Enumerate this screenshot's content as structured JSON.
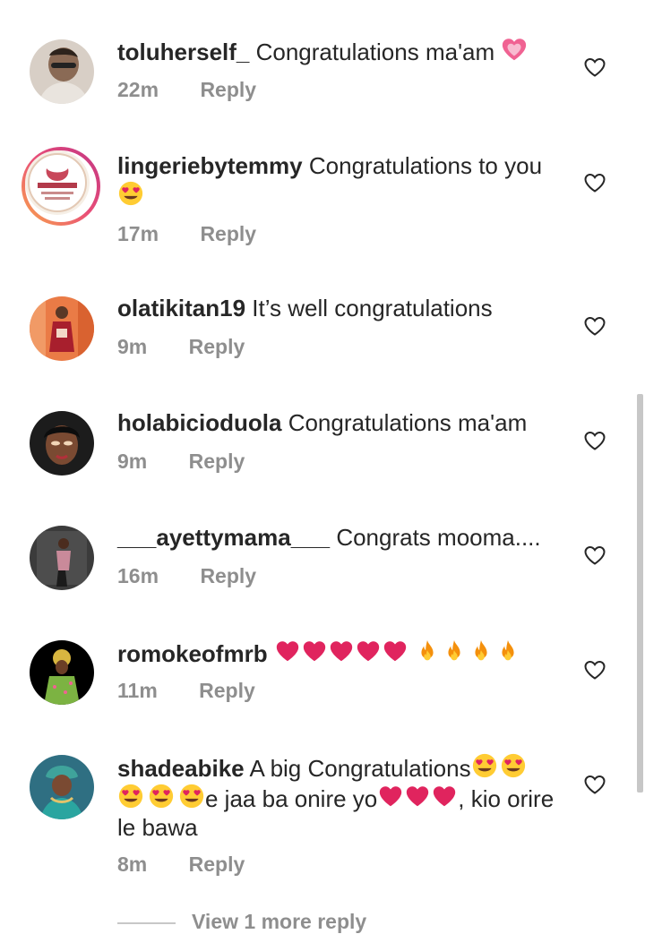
{
  "comments": [
    {
      "username": "toluherself_",
      "text": "Congratulations ma'am",
      "time": "22m",
      "reply": "Reply"
    },
    {
      "username": "lingeriebytemmy",
      "text": "Congratulations to you",
      "time": "17m",
      "reply": "Reply"
    },
    {
      "username": "olatikitan19",
      "text": "It’s well congratulations",
      "time": "9m",
      "reply": "Reply"
    },
    {
      "username": "holabicioduola",
      "text": "Congratulations ma'am",
      "time": "9m",
      "reply": "Reply"
    },
    {
      "username": "___ayettymama___",
      "text": "Congrats mooma....",
      "time": "16m",
      "reply": "Reply"
    },
    {
      "username": "romokeofmrb",
      "text": "",
      "time": "11m",
      "reply": "Reply"
    },
    {
      "username": "shadeabike",
      "text_part1": "A big Congratulations",
      "text_part2": "e jaa ba onire yo",
      "text_part3": ", kio orire le bawa",
      "time": "8m",
      "reply": "Reply"
    }
  ],
  "view_more": "View 1 more reply",
  "icons": {
    "like": "heart-outline-icon",
    "emoji_heart_pulse": "growing-heart-emoji",
    "emoji_heart_eyes": "heart-eyes-emoji",
    "emoji_red_heart": "red-heart-emoji",
    "emoji_fire": "fire-emoji"
  },
  "colors": {
    "text": "#262626",
    "secondary": "#8e8e8e",
    "heart_red": "#e0245e",
    "emoji_yellow": "#ffcc33"
  }
}
